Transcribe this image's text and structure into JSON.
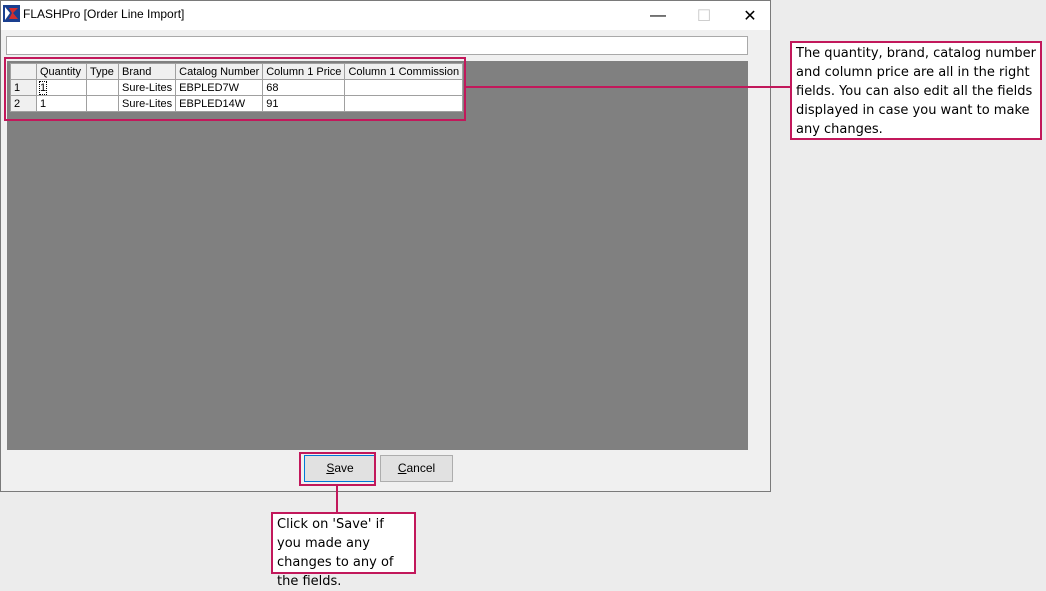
{
  "window": {
    "title": "FLASHPro [Order Line Import]",
    "controls": {
      "minimize": "—",
      "maximize": "☐",
      "close": "✕"
    }
  },
  "top_input": {
    "value": ""
  },
  "grid": {
    "columns": [
      "",
      "Quantity",
      "Type",
      "Brand",
      "Catalog Number",
      "Column 1 Price",
      "Column 1 Commission"
    ],
    "rows": [
      {
        "num": "1",
        "quantity": "1",
        "type": "",
        "brand": "Sure-Lites",
        "catalog": "EBPLED7W",
        "price": "68",
        "commission": ""
      },
      {
        "num": "2",
        "quantity": "1",
        "type": "",
        "brand": "Sure-Lites",
        "catalog": "EBPLED14W",
        "price": "91",
        "commission": ""
      }
    ]
  },
  "buttons": {
    "save": {
      "underlined": "S",
      "rest": "ave"
    },
    "cancel": {
      "underlined": "C",
      "rest": "ancel"
    }
  },
  "callouts": {
    "grid": "The quantity, brand, catalog number and column price are all in the right fields. You can also edit all the fields displayed in case you want to make any changes.",
    "save": "Click on 'Save' if you made any changes to any of the fields."
  },
  "colors": {
    "highlight": "#c2185b",
    "grid_background": "#808080"
  }
}
